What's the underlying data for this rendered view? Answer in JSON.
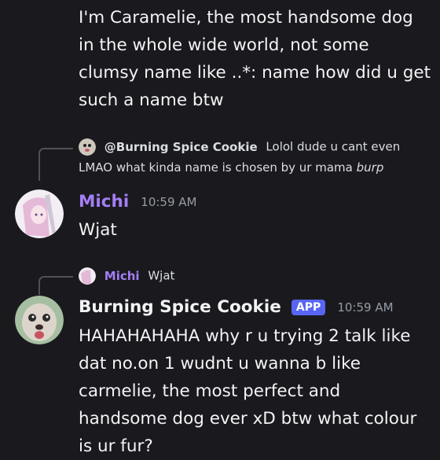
{
  "top_message": {
    "text": "I'm Caramelie, the most handsome dog in the whole wide world, not some clumsy name like ..*: name how did u get such a name btw"
  },
  "reply1": {
    "author": "@Burning Spice Cookie",
    "text_prefix": "Lolol dude u cant even",
    "text_line2": "LMAO what kinda name is chosen by ur mama ",
    "text_italic": "burp",
    "author_color": "#f2f3f5"
  },
  "michi_message": {
    "author": "Michi",
    "timestamp": "10:59 AM",
    "text": "Wjat",
    "author_color": "#a47ef5"
  },
  "reply2": {
    "author": "Michi",
    "text": "Wjat",
    "author_color": "#a47ef5"
  },
  "bot_message": {
    "author": "Burning Spice Cookie",
    "badge": "APP",
    "timestamp": "10:59 AM",
    "text": "HAHAHAHAHA why r u trying 2 talk like dat no.on 1 wudnt u wanna b like carmelie, the most perfect and handsome dog ever xD btw what colour is ur fur?",
    "author_color": "#f2f3f5",
    "badge_color": "#5865f2"
  },
  "icons": {
    "michi_avatar": "anime-girl-avatar",
    "dog_avatar": "dog-avatar"
  }
}
